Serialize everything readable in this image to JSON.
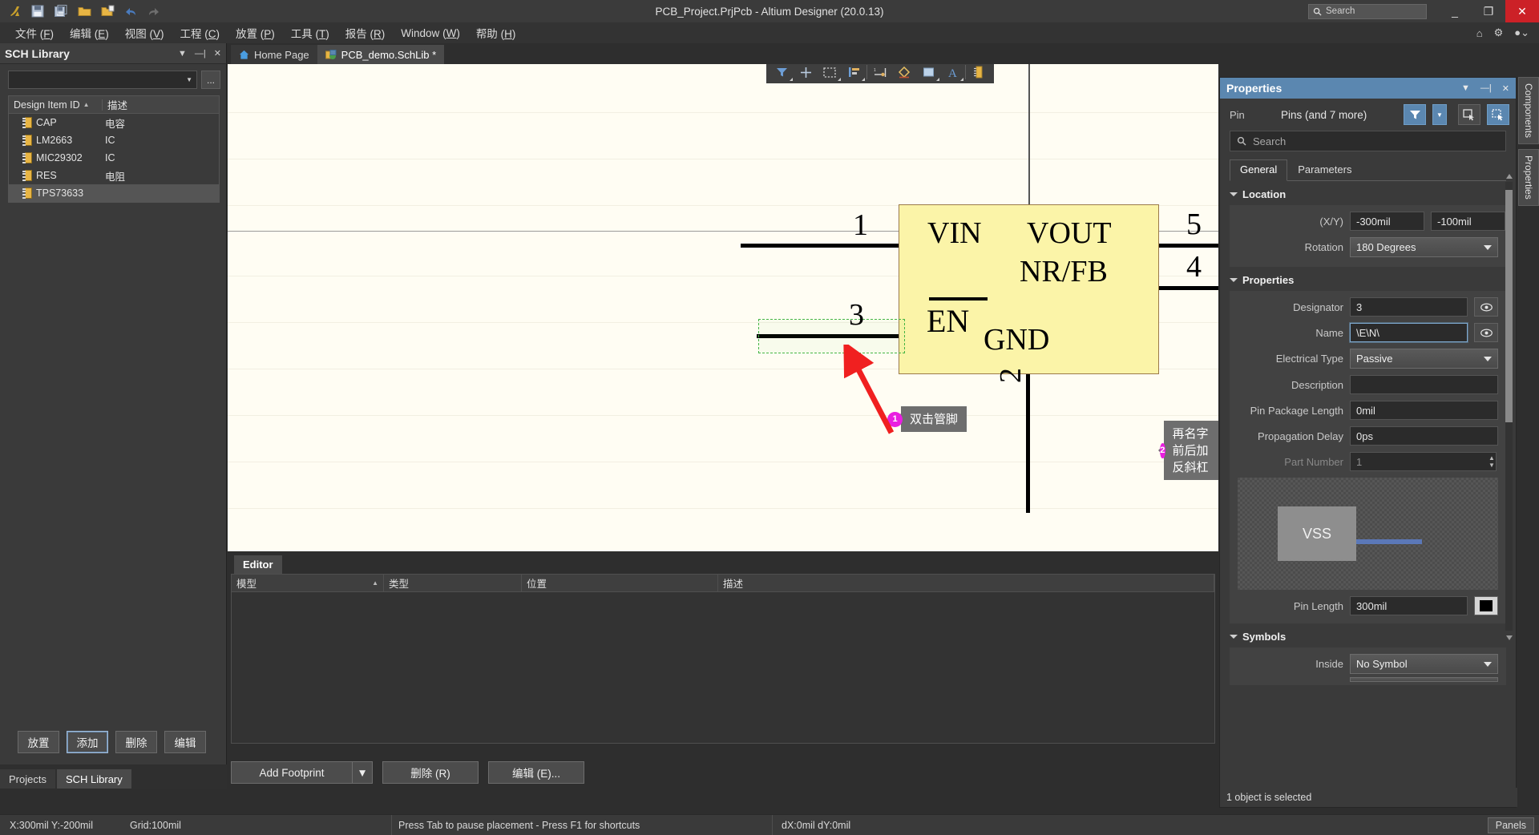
{
  "titlebar": {
    "title": "PCB_Project.PrjPcb - Altium Designer (20.0.13)",
    "search_placeholder": "Search",
    "minimize": "_",
    "restore": "❐",
    "close": "✕",
    "icons": [
      "altium-logo",
      "save-icon",
      "save-all-icon",
      "open-folder-icon",
      "open-project-icon",
      "undo-icon",
      "redo-icon"
    ]
  },
  "menubar": {
    "items": [
      {
        "label": "文件",
        "accel": "F"
      },
      {
        "label": "编辑",
        "accel": "E"
      },
      {
        "label": "视图",
        "accel": "V"
      },
      {
        "label": "工程",
        "accel": "C"
      },
      {
        "label": "放置",
        "accel": "P"
      },
      {
        "label": "工具",
        "accel": "T"
      },
      {
        "label": "报告",
        "accel": "R"
      },
      {
        "label": "Window",
        "accel": "W"
      },
      {
        "label": "帮助",
        "accel": "H"
      }
    ],
    "right_icons": [
      "home-icon",
      "gear-icon",
      "user-icon"
    ]
  },
  "sch_library": {
    "panel_title": "SCH Library",
    "filter_value": "",
    "ellipsis_button": "...",
    "columns": [
      "Design Item ID",
      "描述"
    ],
    "rows": [
      {
        "id": "CAP",
        "desc": "电容",
        "selected": false
      },
      {
        "id": "LM2663",
        "desc": "IC",
        "selected": false
      },
      {
        "id": "MIC29302",
        "desc": "IC",
        "selected": false
      },
      {
        "id": "RES",
        "desc": "电阻",
        "selected": false
      },
      {
        "id": "TPS73633",
        "desc": "",
        "selected": true
      }
    ],
    "buttons": [
      {
        "label": "放置",
        "focused": false
      },
      {
        "label": "添加",
        "focused": true
      },
      {
        "label": "删除",
        "focused": false
      },
      {
        "label": "编辑",
        "focused": false
      }
    ],
    "tabs": [
      {
        "label": "Projects",
        "active": false
      },
      {
        "label": "SCH Library",
        "active": true
      }
    ]
  },
  "doc_tabs": [
    {
      "label": "Home Page",
      "icon": "home-icon",
      "active": false
    },
    {
      "label": "PCB_demo.SchLib *",
      "icon": "schlib-icon",
      "active": true
    }
  ],
  "canvas_toolbar": {
    "buttons": [
      "filter-icon",
      "crosshair-icon",
      "rectangle-select-icon",
      "align-icon",
      "pin-icon",
      "eraser-icon",
      "fill-icon",
      "text-icon",
      "chip-icon"
    ]
  },
  "symbol": {
    "body_labels_left": [
      "VIN"
    ],
    "body_labels_right": [
      "VOUT",
      "NR/FB"
    ],
    "en_label": "EN",
    "gnd_label": "GND",
    "pin_numbers": {
      "vin": "1",
      "gnd": "2",
      "en": "3",
      "nrfb": "4",
      "vout": "5"
    }
  },
  "callouts": [
    {
      "number": "1",
      "text": "双击管脚"
    },
    {
      "number": "2",
      "text": "再名字前后加反斜杠"
    }
  ],
  "editor_panel": {
    "tab": "Editor",
    "columns": [
      "模型",
      "类型",
      "位置",
      "描述"
    ],
    "rows": [],
    "buttons": [
      {
        "label": "Add Footprint",
        "has_dropdown": true
      },
      {
        "label": "删除 (R)",
        "has_dropdown": false
      },
      {
        "label": "编辑 (E)...",
        "has_dropdown": false
      }
    ]
  },
  "properties": {
    "panel_title": "Properties",
    "object_type": "Pin",
    "object_scope": "Pins (and 7 more)",
    "header_icons": [
      "chevron-down-icon",
      "pin-icon",
      "close-icon"
    ],
    "toolbar_icons": [
      "filter-icon",
      "filter-dropdown-icon",
      "select-all-icon",
      "select-touching-icon"
    ],
    "search_placeholder": "Search",
    "tabs": [
      {
        "label": "General",
        "active": true
      },
      {
        "label": "Parameters",
        "active": false
      }
    ],
    "sections": {
      "location": {
        "title": "Location",
        "xy_label": "(X/Y)",
        "x": "-300mil",
        "y": "-100mil",
        "rotation_label": "Rotation",
        "rotation": "180 Degrees"
      },
      "properties": {
        "title": "Properties",
        "fields": [
          {
            "label": "Designator",
            "value": "3",
            "type": "text",
            "eye": true,
            "focused": false
          },
          {
            "label": "Name",
            "value": "\\E\\N\\",
            "type": "text",
            "eye": true,
            "focused": true
          },
          {
            "label": "Electrical Type",
            "value": "Passive",
            "type": "select",
            "eye": false,
            "focused": false
          },
          {
            "label": "Description",
            "value": "",
            "type": "text",
            "eye": false,
            "focused": false
          },
          {
            "label": "Pin Package Length",
            "value": "0mil",
            "type": "text",
            "eye": false,
            "focused": false
          },
          {
            "label": "Propagation Delay",
            "value": "0ps",
            "type": "text",
            "eye": false,
            "focused": false
          },
          {
            "label": "Part Number",
            "value": "1",
            "type": "spinner",
            "eye": false,
            "focused": false,
            "dim": true
          }
        ],
        "preview_label": "VSS",
        "pin_length_label": "Pin Length",
        "pin_length_value": "300mil",
        "pin_color": "#000000"
      },
      "symbols": {
        "title": "Symbols",
        "inside_label": "Inside",
        "inside_value": "No Symbol"
      }
    },
    "status": "1 object is selected"
  },
  "vertical_tabs": [
    {
      "label": "Components"
    },
    {
      "label": "Properties"
    }
  ],
  "statusbar": {
    "coords": "X:300mil Y:-200mil",
    "grid": "Grid:100mil",
    "hint": "Press Tab to pause placement - Press F1 for shortcuts",
    "delta": "dX:0mil dY:0mil",
    "panels_button": "Panels"
  },
  "colors": {
    "accent_blue": "#5b87b0",
    "badge_magenta": "#e91ee0",
    "arrow_red": "#f02020",
    "symbol_fill": "#fbf4a8",
    "symbol_border": "#9b7a4a",
    "canvas_bg": "#fffdf3",
    "close_red": "#cc2127"
  }
}
